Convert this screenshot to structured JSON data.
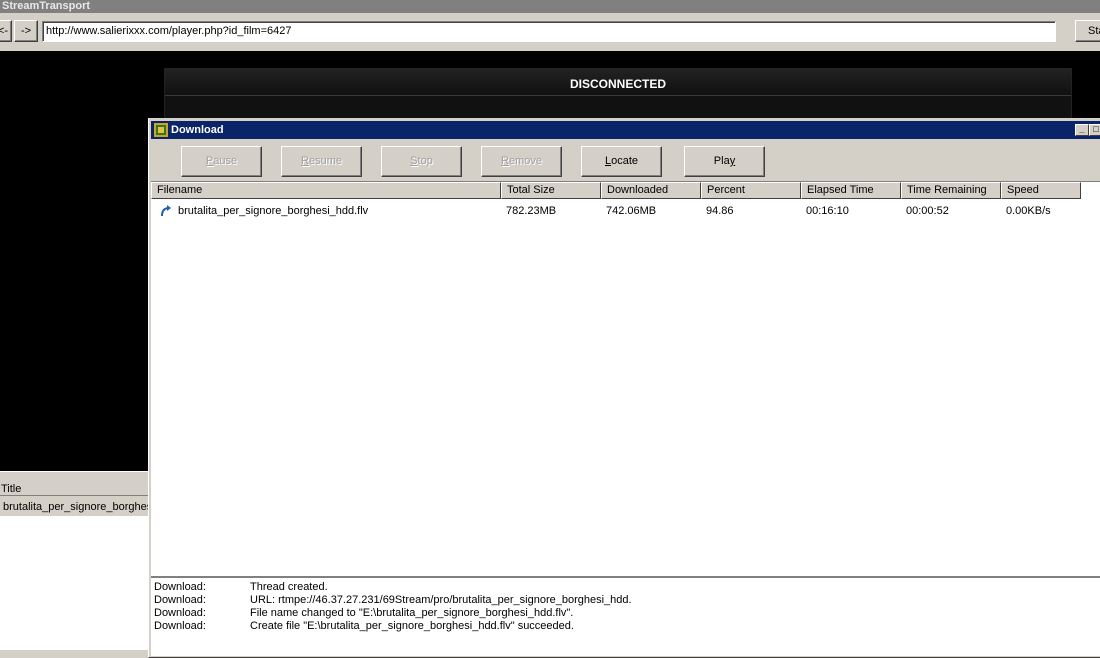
{
  "app": {
    "title": "StreamTransport"
  },
  "nav": {
    "back_label": "<-",
    "forward_label": "->",
    "url": "http://www.salierixxx.com/player.php?id_film=6427",
    "start_label": "Start"
  },
  "player": {
    "status": "DISCONNECTED"
  },
  "left_list": {
    "header": "Title",
    "rows": [
      {
        "title": "brutalita_per_signore_borghesi_hdd.flv"
      }
    ]
  },
  "download": {
    "title": "Download",
    "buttons": {
      "pause": {
        "first": "P",
        "rest": "ause"
      },
      "resume": {
        "first": "R",
        "rest": "esume"
      },
      "stop": {
        "first": "S",
        "rest": "top"
      },
      "remove": {
        "first": "R",
        "rest": "emove"
      },
      "locate": {
        "first": "L",
        "rest": "ocate"
      },
      "play": {
        "first": "Pla",
        "ul": "y"
      }
    },
    "columns": [
      "Filename",
      "Total Size",
      "Downloaded",
      "Percent",
      "Elapsed Time",
      "Time Remaining",
      "Speed"
    ],
    "rows": [
      {
        "filename": "brutalita_per_signore_borghesi_hdd.flv",
        "total_size": "782.23MB",
        "downloaded": "742.06MB",
        "percent": "94.86",
        "elapsed": "00:16:10",
        "remaining": "00:00:52",
        "speed": "0.00KB/s"
      }
    ],
    "log": [
      {
        "source": "Download:",
        "message": "Thread created."
      },
      {
        "source": "Download:",
        "message": "URL: rtmpe://46.37.27.231/69Stream/pro/brutalita_per_signore_borghesi_hdd."
      },
      {
        "source": "Download:",
        "message": "File name changed to \"E:\\brutalita_per_signore_borghesi_hdd.flv\"."
      },
      {
        "source": "Download:",
        "message": "Create file \"E:\\brutalita_per_signore_borghesi_hdd.flv\" succeeded."
      }
    ]
  }
}
